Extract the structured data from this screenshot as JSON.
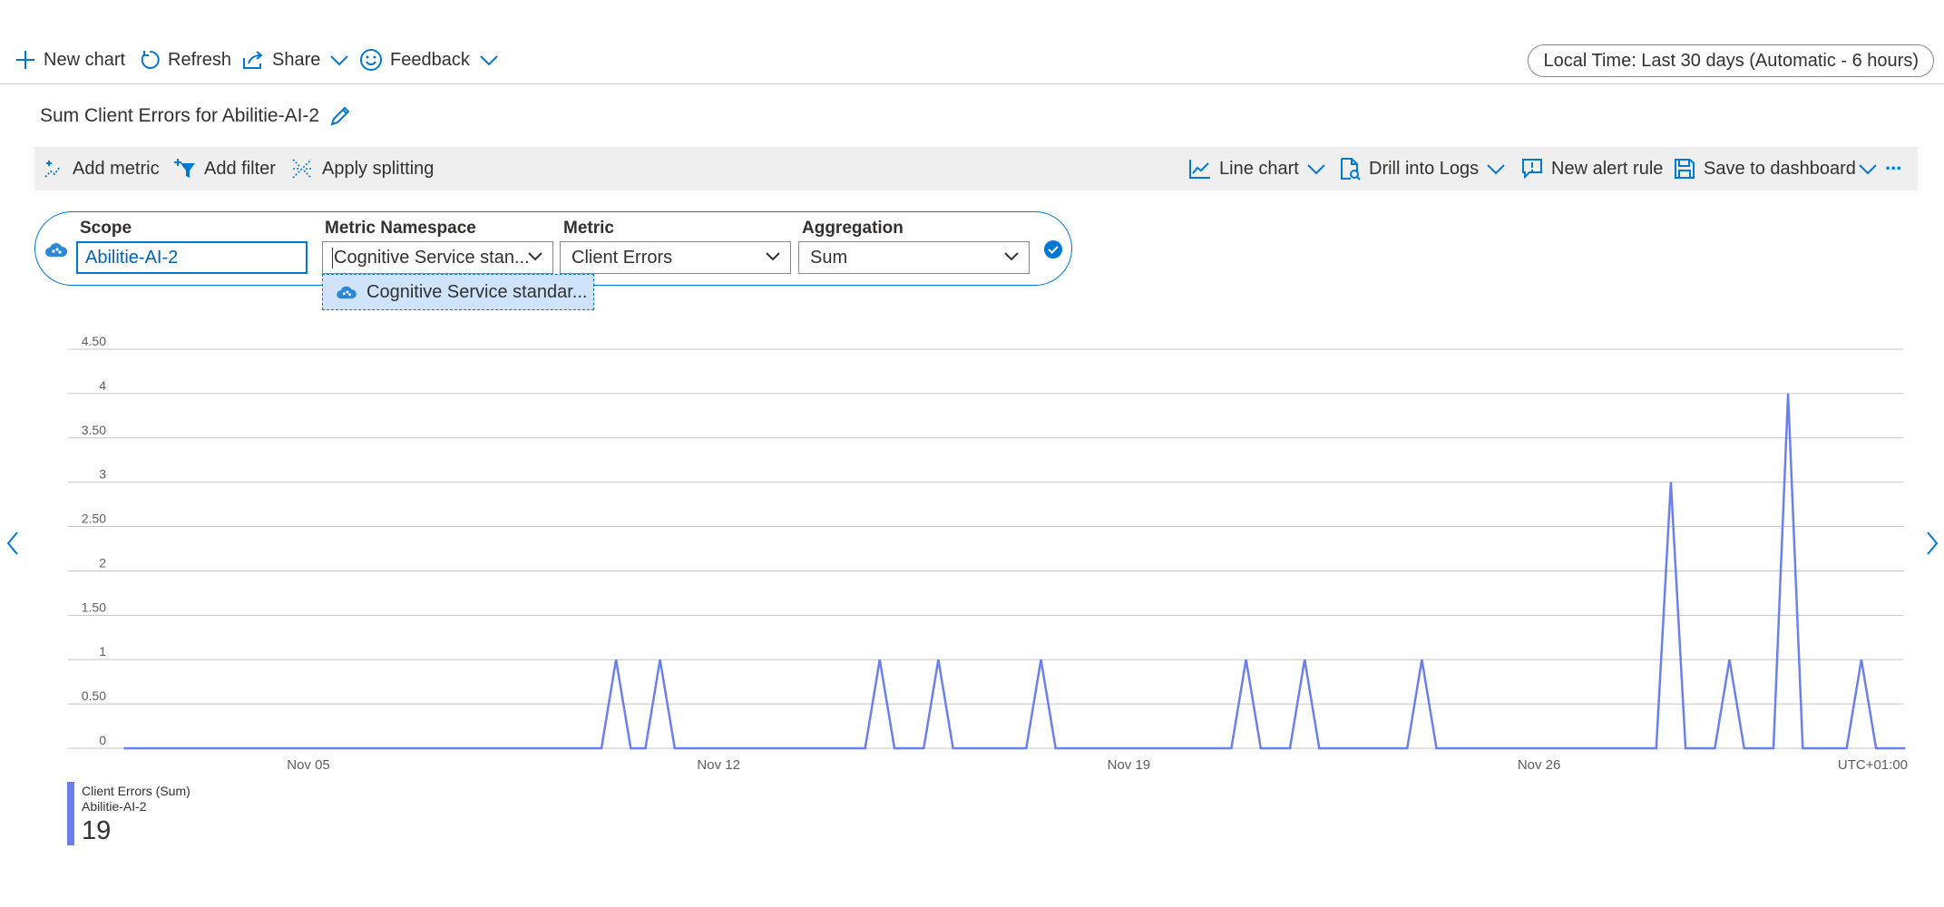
{
  "topbar": {
    "new_chart": "New chart",
    "refresh": "Refresh",
    "share": "Share",
    "feedback": "Feedback",
    "time_range": "Local Time: Last 30 days (Automatic - 6 hours)"
  },
  "chart": {
    "title": "Sum Client Errors for Abilitie-AI-2"
  },
  "toolbar": {
    "add_metric": "Add metric",
    "add_filter": "Add filter",
    "apply_splitting": "Apply splitting",
    "line_chart": "Line chart",
    "drill_into_logs": "Drill into Logs",
    "new_alert_rule": "New alert rule",
    "save_to_dashboard": "Save to dashboard",
    "more": "..."
  },
  "metric_row": {
    "scope_label": "Scope",
    "scope_value": "Abilitie-AI-2",
    "namespace_label": "Metric Namespace",
    "namespace_value": "Cognitive Service stan...",
    "metric_label": "Metric",
    "metric_value": "Client Errors",
    "aggregation_label": "Aggregation",
    "aggregation_value": "Sum",
    "namespace_option": "Cognitive Service standar..."
  },
  "legend": {
    "series_name": "Client Errors (Sum)",
    "resource": "Abilitie-AI-2",
    "total": "19"
  },
  "colors": {
    "accent": "#0078d4",
    "series": "#6b80ec",
    "toolbar_bg": "#efefef",
    "selected_option_bg": "#cfe4fa"
  },
  "chart_data": {
    "type": "line",
    "title": "Sum Client Errors for Abilitie-AI-2",
    "xlabel": "",
    "ylabel": "",
    "ylim": [
      0,
      4.5
    ],
    "y_ticks": [
      "0",
      "0.50",
      "1",
      "1.50",
      "2",
      "2.50",
      "3",
      "3.50",
      "4",
      "4.50"
    ],
    "x_ticks": [
      "Nov 05",
      "Nov 12",
      "Nov 19",
      "Nov 26",
      "UTC+01:00"
    ],
    "grid": true,
    "legend_position": "bottom-left",
    "series": [
      {
        "name": "Client Errors (Sum)",
        "x_days": [
          1.85,
          10.0,
          10.25,
          10.5,
          10.75,
          11.0,
          11.25,
          11.5,
          14.5,
          14.75,
          15.0,
          15.25,
          15.5,
          15.75,
          16.0,
          16.25,
          16.5,
          17.25,
          17.5,
          17.75,
          18.0,
          18.25,
          18.5,
          18.75,
          20.75,
          21.0,
          21.25,
          21.5,
          21.75,
          22.0,
          22.25,
          22.5,
          22.75,
          23.75,
          24.0,
          24.25,
          24.5,
          28.0,
          28.25,
          28.5,
          29.0,
          29.25,
          29.5,
          29.75,
          30.0,
          30.25,
          30.5,
          31.0,
          31.25,
          31.5,
          31.75,
          32.25
        ],
        "values": [
          0,
          0,
          1,
          0,
          0,
          1,
          0,
          0,
          0,
          1,
          0,
          0,
          0,
          1,
          0,
          0,
          0,
          0,
          1,
          0,
          0,
          0,
          0,
          0,
          0,
          1,
          0,
          0,
          0,
          1,
          0,
          0,
          0,
          0,
          1,
          0,
          0,
          0,
          3,
          0,
          0,
          1,
          0,
          0,
          0,
          4,
          0,
          0,
          0,
          1,
          0,
          0
        ]
      }
    ]
  }
}
